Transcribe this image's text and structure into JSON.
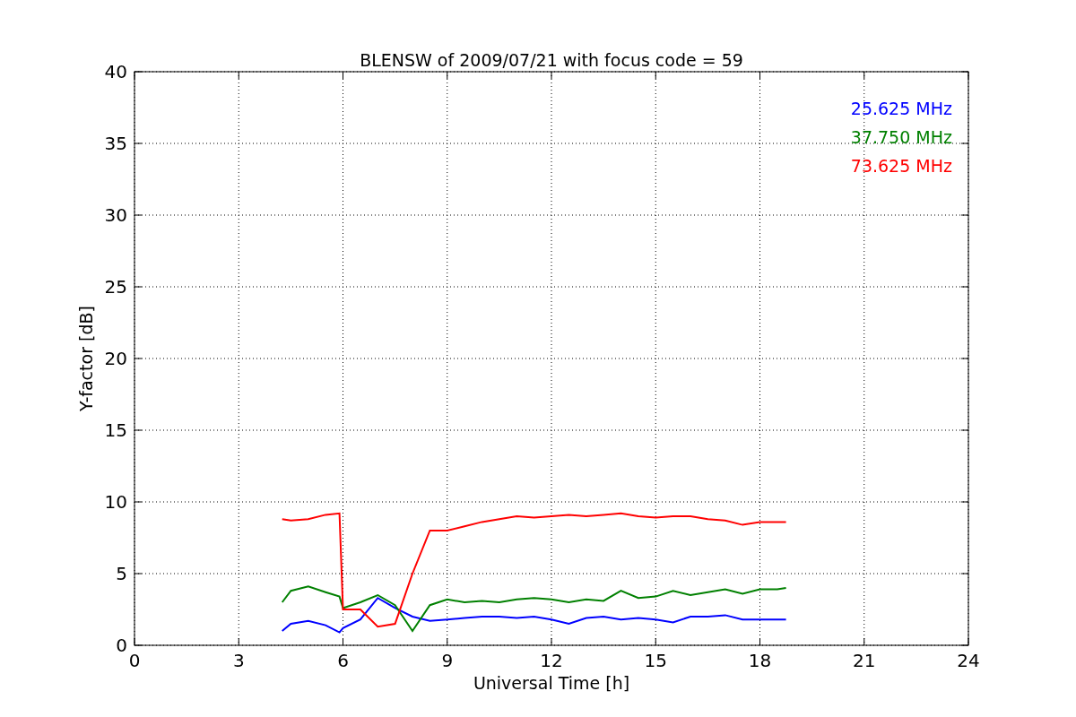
{
  "figure": {
    "chart_data": {
      "type": "line",
      "title": "BLENSW of 2009/07/21 with focus code = 59",
      "xlabel": "Universal Time [h]",
      "ylabel": "Y-factor [dB]",
      "x": [
        4.25,
        4.5,
        5,
        5.5,
        5.9,
        6,
        6.5,
        7,
        7.5,
        8,
        8.5,
        9,
        9.5,
        10,
        10.5,
        11,
        11.5,
        12,
        12.5,
        13,
        13.5,
        14,
        14.5,
        15,
        15.5,
        16,
        16.5,
        17,
        17.5,
        18,
        18.5,
        18.75
      ],
      "series": [
        {
          "name": "25.625 MHz",
          "color": "#0000ff",
          "values": [
            1,
            1.5,
            1.7,
            1.4,
            0.9,
            1.2,
            1.8,
            3.3,
            2.6,
            2.0,
            1.7,
            1.8,
            1.9,
            2,
            2,
            1.9,
            2,
            1.8,
            1.5,
            1.9,
            2,
            1.8,
            1.9,
            1.8,
            1.6,
            2,
            2,
            2.1,
            1.8,
            1.8,
            1.8,
            1.8
          ]
        },
        {
          "name": "37.750 MHz",
          "color": "#008000",
          "values": [
            3,
            3.8,
            4.1,
            3.7,
            3.4,
            2.6,
            3,
            3.5,
            2.8,
            1,
            2.8,
            3.2,
            3,
            3.1,
            3,
            3.2,
            3.3,
            3.2,
            3,
            3.2,
            3.1,
            3.8,
            3.3,
            3.4,
            3.8,
            3.5,
            3.7,
            3.9,
            3.6,
            3.9,
            3.9,
            4
          ]
        },
        {
          "name": "73.625 MHz",
          "color": "#ff0000",
          "values": [
            8.8,
            8.7,
            8.8,
            9.1,
            9.2,
            2.5,
            2.5,
            1.3,
            1.5,
            5,
            8,
            8,
            8.3,
            8.6,
            8.8,
            9,
            8.9,
            9,
            9.1,
            9,
            9.1,
            9.2,
            9,
            8.9,
            9,
            9,
            8.8,
            8.7,
            8.4,
            8.6,
            8.6,
            8.6
          ]
        }
      ],
      "xlim": [
        0,
        24
      ],
      "ylim": [
        0,
        40
      ],
      "xticks": [
        0,
        3,
        6,
        9,
        12,
        15,
        18,
        21,
        24
      ],
      "yticks": [
        0,
        5,
        10,
        15,
        20,
        25,
        30,
        35,
        40
      ],
      "grid": true
    }
  }
}
